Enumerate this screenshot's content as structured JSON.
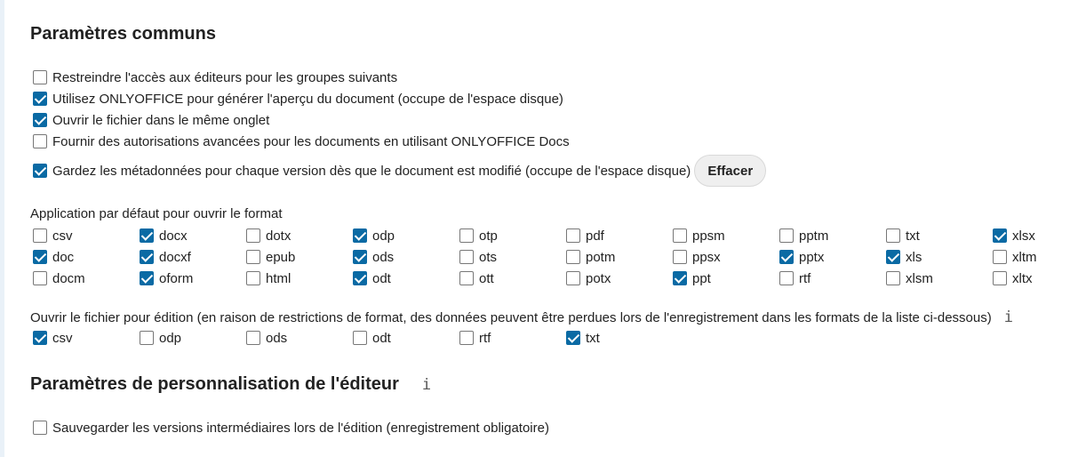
{
  "common": {
    "title": "Paramètres communs",
    "options": [
      {
        "label": "Restreindre l'accès aux éditeurs pour les groupes suivants",
        "checked": false
      },
      {
        "label": "Utilisez ONLYOFFICE pour générer l'aperçu du document (occupe de l'espace disque)",
        "checked": true
      },
      {
        "label": "Ouvrir le fichier dans le même onglet",
        "checked": true
      },
      {
        "label": "Fournir des autorisations avancées pour les documents en utilisant ONLYOFFICE Docs",
        "checked": false
      },
      {
        "label": "Gardez les métadonnées pour chaque version dès que le document est modifié (occupe de l'espace disque)",
        "checked": true
      }
    ],
    "clear_button": "Effacer"
  },
  "default_app": {
    "label": "Application par défaut pour ouvrir le format",
    "formats": [
      {
        "name": "csv",
        "checked": false
      },
      {
        "name": "docx",
        "checked": true
      },
      {
        "name": "dotx",
        "checked": false
      },
      {
        "name": "odp",
        "checked": true
      },
      {
        "name": "otp",
        "checked": false
      },
      {
        "name": "pdf",
        "checked": false
      },
      {
        "name": "ppsm",
        "checked": false
      },
      {
        "name": "pptm",
        "checked": false
      },
      {
        "name": "txt",
        "checked": false
      },
      {
        "name": "xlsx",
        "checked": true
      },
      {
        "name": "doc",
        "checked": true
      },
      {
        "name": "docxf",
        "checked": true
      },
      {
        "name": "epub",
        "checked": false
      },
      {
        "name": "ods",
        "checked": true
      },
      {
        "name": "ots",
        "checked": false
      },
      {
        "name": "potm",
        "checked": false
      },
      {
        "name": "ppsx",
        "checked": false
      },
      {
        "name": "pptx",
        "checked": true
      },
      {
        "name": "xls",
        "checked": true
      },
      {
        "name": "xltm",
        "checked": false
      },
      {
        "name": "docm",
        "checked": false
      },
      {
        "name": "oform",
        "checked": true
      },
      {
        "name": "html",
        "checked": false
      },
      {
        "name": "odt",
        "checked": true
      },
      {
        "name": "ott",
        "checked": false
      },
      {
        "name": "potx",
        "checked": false
      },
      {
        "name": "ppt",
        "checked": true
      },
      {
        "name": "rtf",
        "checked": false
      },
      {
        "name": "xlsm",
        "checked": false
      },
      {
        "name": "xltx",
        "checked": false
      }
    ]
  },
  "edit_formats": {
    "label": "Ouvrir le fichier pour édition (en raison de restrictions de format, des données peuvent être perdues lors de l'enregistrement dans les formats de la liste ci-dessous)",
    "info_icon": "i",
    "formats": [
      {
        "name": "csv",
        "checked": true
      },
      {
        "name": "odp",
        "checked": false
      },
      {
        "name": "ods",
        "checked": false
      },
      {
        "name": "odt",
        "checked": false
      },
      {
        "name": "rtf",
        "checked": false
      },
      {
        "name": "txt",
        "checked": true
      }
    ]
  },
  "editor": {
    "title": "Paramètres de personnalisation de l'éditeur",
    "info_icon": "i",
    "options": [
      {
        "label": "Sauvegarder les versions intermédiaires lors de l'édition (enregistrement obligatoire)",
        "checked": false
      }
    ]
  },
  "colors": {
    "accent": "#0a6aa4",
    "sidebar": "#e9f1f8"
  }
}
